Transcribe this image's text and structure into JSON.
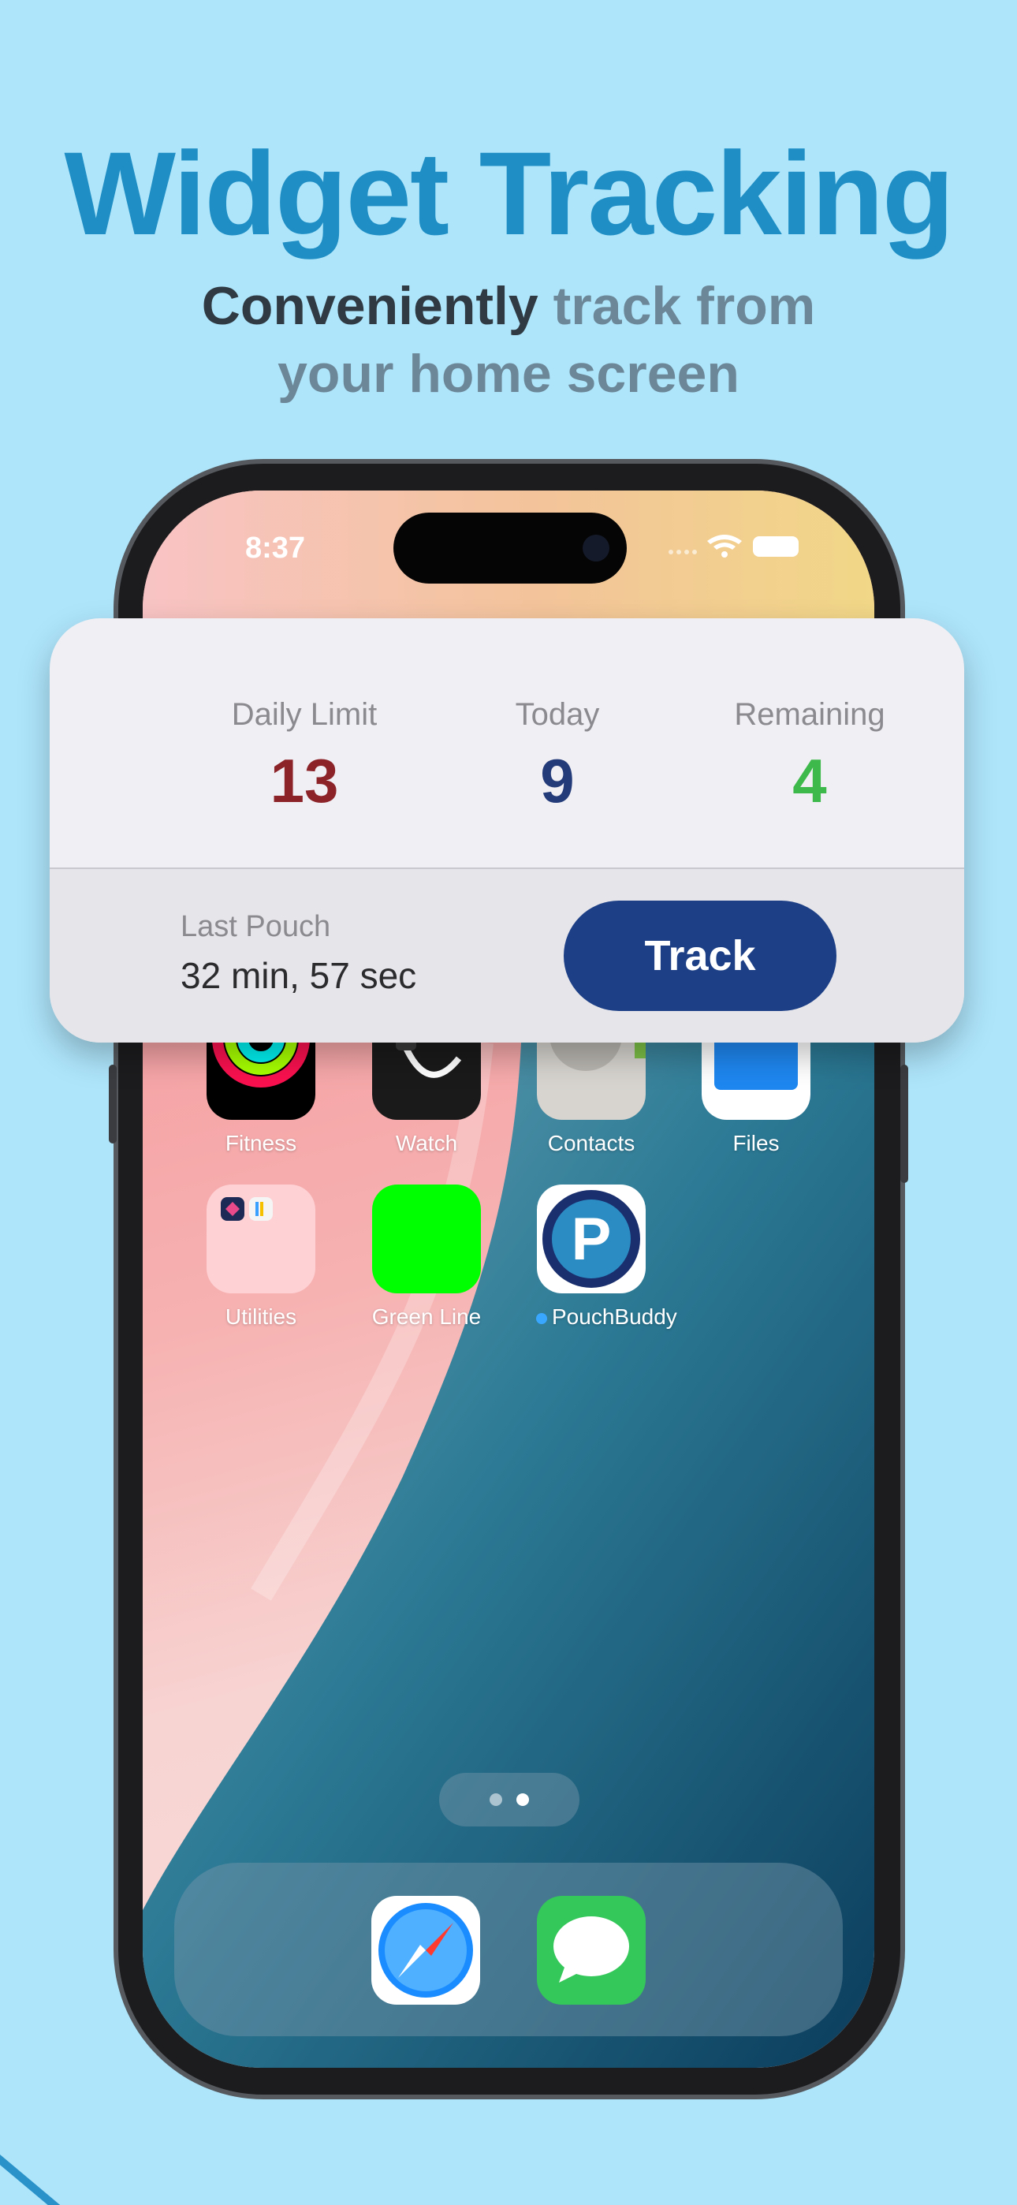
{
  "headline": "Widget Tracking",
  "subline": {
    "part1": "Conveniently",
    "part2": "track from",
    "part3": "your home screen"
  },
  "status_bar": {
    "time": "8:37"
  },
  "widget": {
    "daily_limit": {
      "label": "Daily Limit",
      "value": "13",
      "color": "#8b2329"
    },
    "today": {
      "label": "Today",
      "value": "9",
      "color": "#243b7a"
    },
    "remaining": {
      "label": "Remaining",
      "value": "4",
      "color": "#3db84a"
    },
    "last_pouch": {
      "label": "Last Pouch",
      "value": "32 min, 57 sec"
    },
    "track_button": "Track"
  },
  "apps": [
    {
      "label": "Fitness",
      "icon": "fitness-icon"
    },
    {
      "label": "Watch",
      "icon": "watch-icon"
    },
    {
      "label": "Contacts",
      "icon": "contacts-icon"
    },
    {
      "label": "Files",
      "icon": "files-icon"
    },
    {
      "label": "Utilities",
      "icon": "folder-icon"
    },
    {
      "label": "Green Line",
      "icon": "green-square-icon"
    },
    {
      "label": "PouchBuddy",
      "icon": "pouchbuddy-icon"
    }
  ],
  "dock": [
    {
      "icon": "safari-icon"
    },
    {
      "icon": "messages-icon"
    }
  ],
  "pouchbuddy_letter": "P",
  "colors": {
    "background": "#aee5fb",
    "headline": "#1e8ec4",
    "track_button": "#1c3f86"
  }
}
